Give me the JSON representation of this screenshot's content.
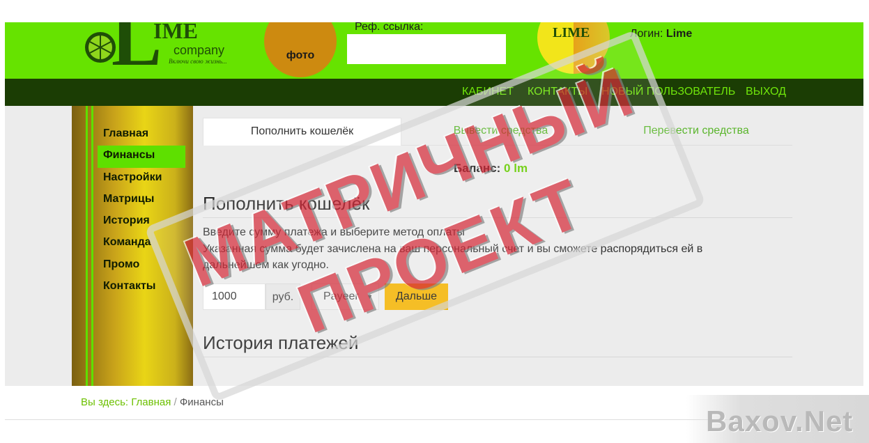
{
  "header": {
    "logo": {
      "letter": "L",
      "name_part": "IME",
      "company": "company",
      "slogan": "Включи свою жизнь..."
    },
    "photo_label": "фото",
    "ref_label": "Реф. ссылка:",
    "ref_value": "",
    "avatar_logo": "LIME",
    "login_label": "Логин:",
    "login_value": "Lime"
  },
  "nav": {
    "items": [
      "КАБИНЕТ",
      "КОНТАКТЫ",
      "НОВЫЙ ПОЛЬЗОВАТЕЛЬ",
      "ВЫХОД"
    ]
  },
  "sidebar": {
    "items": [
      "Главная",
      "Финансы",
      "Настройки",
      "Матрицы",
      "История",
      "Команда",
      "Промо",
      "Контакты"
    ],
    "active": "Финансы"
  },
  "tabs": {
    "items": [
      "Пополнить кошелёк",
      "Вывести средства",
      "Перевести средства"
    ],
    "active": "Пополнить кошелёк"
  },
  "balance": {
    "label": "Баланс:",
    "value": "0 lm"
  },
  "topup": {
    "title": "Пополнить кошелёк",
    "desc_line1": "Введите сумму платежа и выберите метод оплаты",
    "desc_line2": "Указанная сумма будет зачислена на ваш персональный счет и вы сможете распорядиться ей в дальнейшем как угодно.",
    "amount": "1000",
    "currency": "руб.",
    "method": "Payeer",
    "submit": "Дальше"
  },
  "history": {
    "title": "История платежей"
  },
  "breadcrumb": {
    "prefix": "Вы здесь:",
    "home": "Главная",
    "separator": "/",
    "current": "Финансы"
  },
  "watermarks": {
    "stamp_line1": "МАТРИЧНЫЙ",
    "stamp_line2": "ПРОЕКТ",
    "site": "Baxov.Net"
  },
  "colors": {
    "lime": "#66e300",
    "nav_dark": "#1b3d04",
    "button": "#f4b60c",
    "stamp_red": "#d62e3c"
  }
}
